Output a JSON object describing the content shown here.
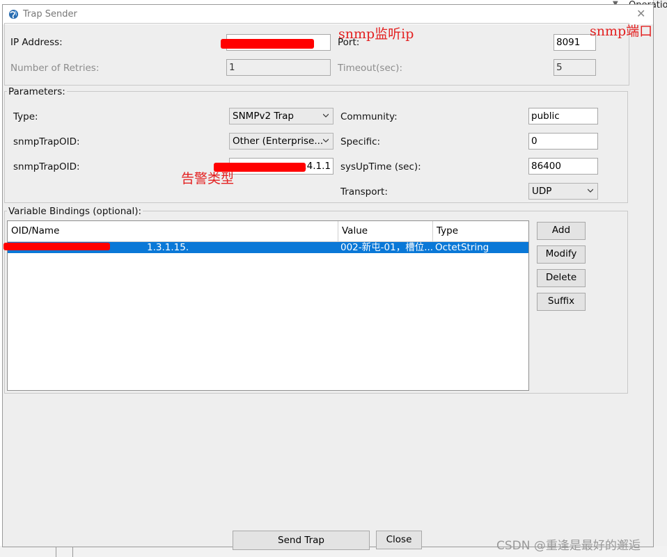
{
  "background": {
    "operation_label": "Operatio"
  },
  "dialog": {
    "title": "Trap Sender",
    "connection": {
      "ip_label": "IP Address:",
      "port_label": "Port:",
      "port_value": "8091",
      "retries_label": "Number of Retries:",
      "retries_value": "1",
      "timeout_label": "Timeout(sec):",
      "timeout_value": "5"
    },
    "parameters": {
      "title": "Parameters:",
      "type_label": "Type:",
      "type_value": "SNMPv2 Trap",
      "trapoid1_label": "snmpTrapOID:",
      "trapoid1_value": "Other (Enterprise...",
      "trapoid2_label": "snmpTrapOID:",
      "trapoid2_value": ".4.1.1",
      "community_label": "Community:",
      "community_value": "public",
      "specific_label": "Specific:",
      "specific_value": "0",
      "sysuptime_label": "sysUpTime (sec):",
      "sysuptime_value": "86400",
      "transport_label": "Transport:",
      "transport_value": "UDP"
    },
    "bindings": {
      "title": "Variable Bindings (optional):",
      "columns": [
        "OID/Name",
        "Value",
        "Type"
      ],
      "rows": [
        {
          "oid": "1.3.1.15.",
          "value": "002-新屯-01，槽位...",
          "type": "OctetString"
        }
      ],
      "buttons": {
        "add": "Add",
        "modify": "Modify",
        "delete": "Delete",
        "suffix": "Suffix"
      }
    },
    "footer": {
      "send": "Send Trap",
      "close": "Close"
    }
  },
  "annotations": {
    "listen_ip": "snmp监听ip",
    "port": "snmp端口",
    "alarm_type": "告警类型"
  },
  "watermark": "CSDN @重逢是最好的邂逅",
  "colors": {
    "selection": "#0a78d7",
    "annotation": "#e32020",
    "redaction": "#ff0000"
  }
}
